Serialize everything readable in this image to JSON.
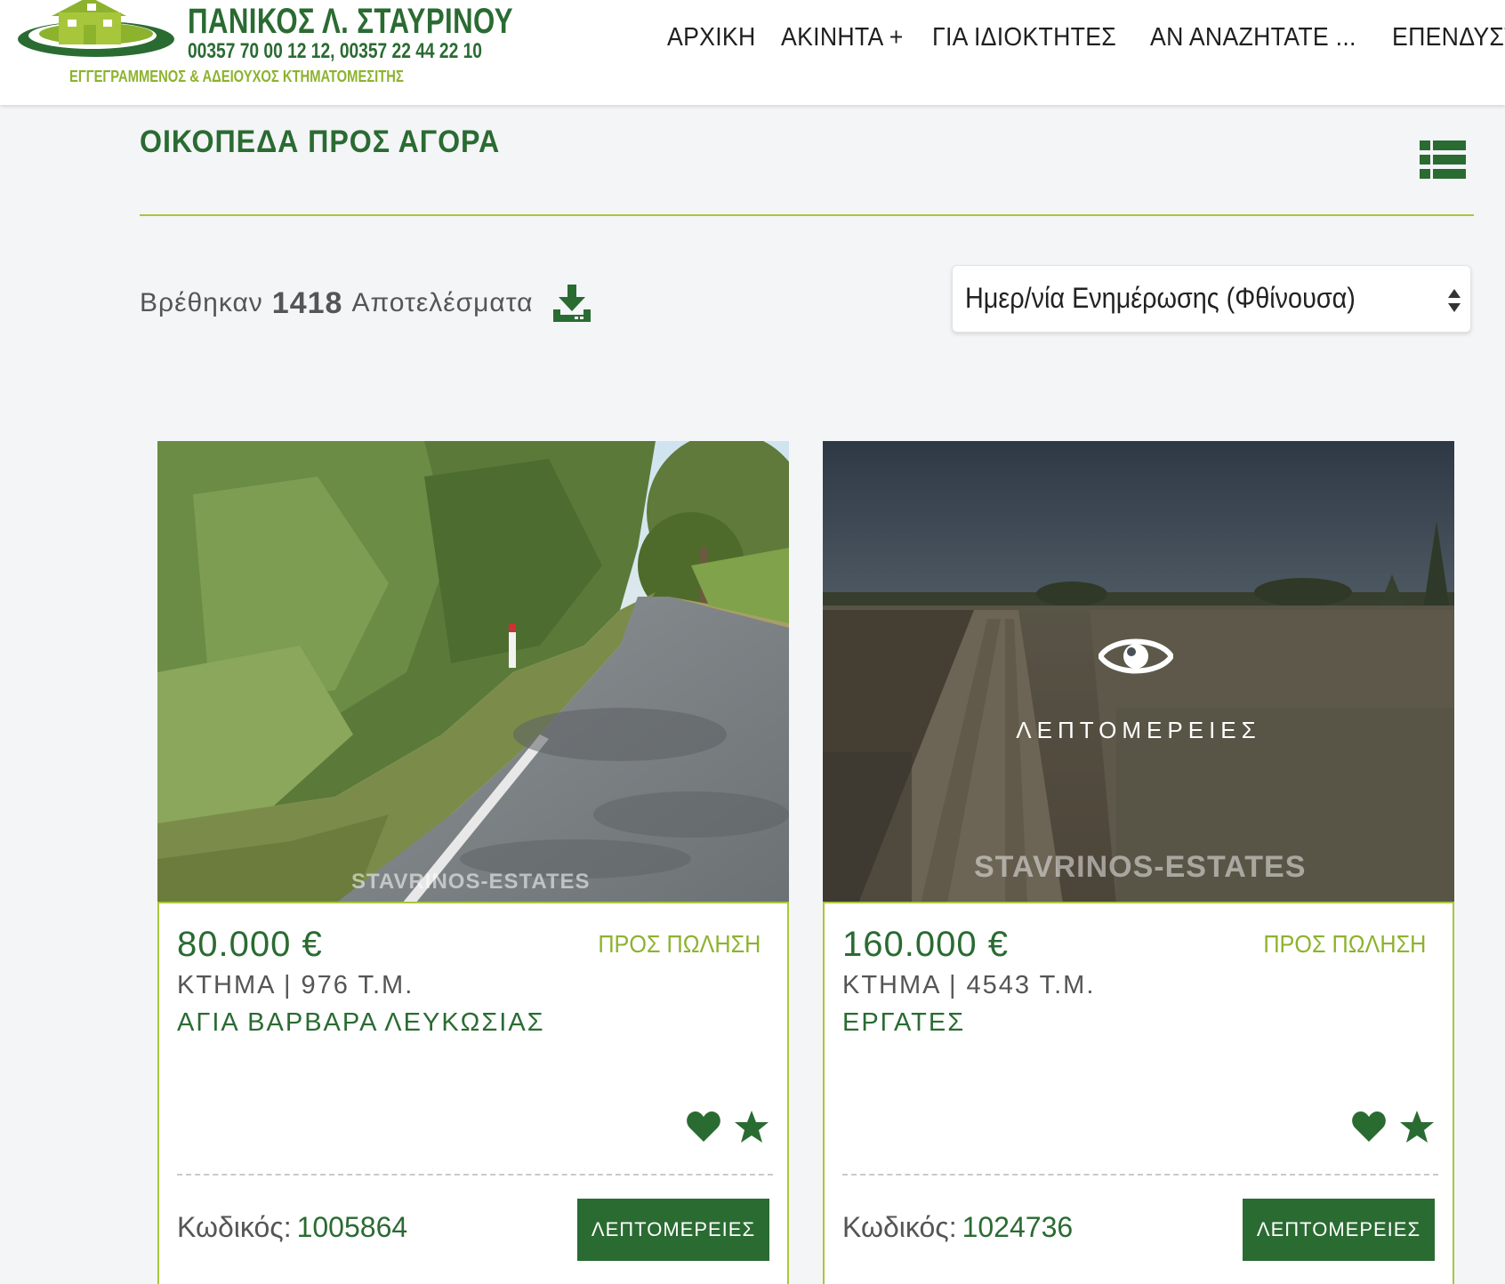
{
  "header": {
    "logo_name": "ΠΑΝΙΚΟΣ Λ. ΣΤΑΥΡΙΝΟΥ",
    "logo_phone": "00357 70 00 12 12,  00357 22 44 22 10",
    "logo_sub": "ΕΓΓΕΓΡΑΜΜΕΝΟΣ & ΑΔΕΙΟΥΧΟΣ ΚΤΗΜΑΤΟΜΕΣΙΤΗΣ",
    "nav": [
      "ΑΡΧΙΚΗ",
      "ΑΚΙΝΗΤΑ +",
      "ΓΙΑ ΙΔΙΟΚΤΗΤΕΣ",
      "ΑΝ ΑΝΑΖΗΤΑΤΕ ...",
      "ΕΠΕΝΔΥΣΤΕ ΣΤ"
    ]
  },
  "page": {
    "title": "ΟΙΚΟΠΕΔΑ ΠΡΟΣ ΑΓΟΡΑ",
    "results_prefix": "Βρέθηκαν",
    "results_count": "1418",
    "results_suffix": "Αποτελέσματα",
    "sort_value": "Ημερ/νία Ενημέρωσης (Φθίνουσα)"
  },
  "icons": {
    "list_view": "list-view-icon",
    "download": "download-icon",
    "sort_arrows": "sort-arrows-icon",
    "eye": "eye-icon",
    "favorite": "heart-icon",
    "shortlist": "star-icon"
  },
  "colors": {
    "brand_green": "#2a6b32",
    "accent_lime": "#a8c63c",
    "status_green": "#8db22e"
  },
  "listings": [
    {
      "price": "80.000 €",
      "status": "ΠΡΟΣ ΠΩΛΗΣΗ",
      "specs": "ΚΤΗΜΑ   |   976 Τ.Μ.",
      "location": "ΑΓΙΑ ΒΑΡΒΑΡΑ ΛΕΥΚΩΣΙΑΣ",
      "code_label": "Κωδικός:",
      "code": "1005864",
      "button": "ΛΕΠΤΟΜΕΡΕΙΕΣ",
      "watermark": "STAVRINOS-ESTATES"
    },
    {
      "price": "160.000 €",
      "status": "ΠΡΟΣ ΠΩΛΗΣΗ",
      "specs": "ΚΤΗΜΑ   |   4543 Τ.Μ.",
      "location": "ΕΡΓΑΤΕΣ",
      "code_label": "Κωδικός:",
      "code": "1024736",
      "button": "ΛΕΠΤΟΜΕΡΕΙΕΣ",
      "watermark": "STAVRINOS-ESTATES",
      "overlay_label": "ΛΕΠΤΟΜΕΡΕΙΕΣ"
    }
  ]
}
